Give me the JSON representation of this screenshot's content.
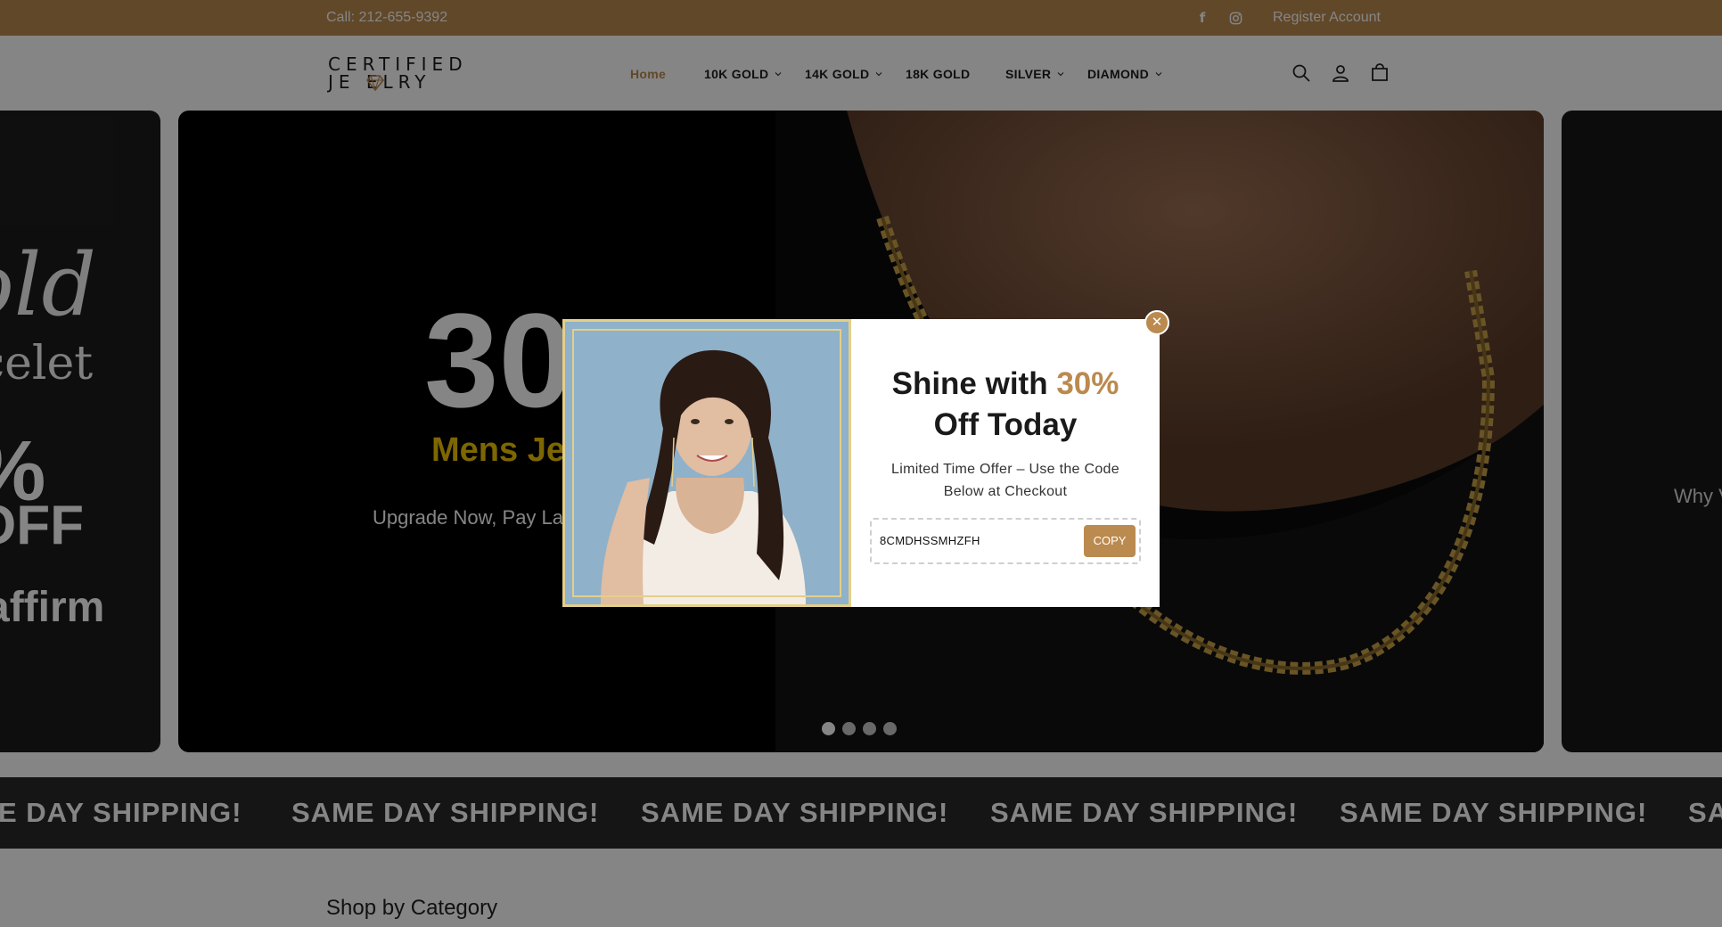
{
  "topbar": {
    "phone": "Call: 212-655-9392",
    "facebook_icon": "facebook-icon",
    "instagram_icon": "instagram-icon",
    "register": "Register Account"
  },
  "header": {
    "logo_line1": "CERTIFIED",
    "logo_line2": "JE  ELRY",
    "nav": [
      {
        "label": "Home",
        "active": true,
        "dropdown": false
      },
      {
        "label": "10K GOLD",
        "active": false,
        "dropdown": true
      },
      {
        "label": "14K GOLD",
        "active": false,
        "dropdown": true
      },
      {
        "label": "18K GOLD",
        "active": false,
        "dropdown": false
      },
      {
        "label": "SILVER",
        "active": false,
        "dropdown": true
      },
      {
        "label": "DIAMOND",
        "active": false,
        "dropdown": true
      }
    ],
    "icons": [
      "search-icon",
      "account-icon",
      "cart-icon"
    ]
  },
  "hero": {
    "left_slide": {
      "line1": "old",
      "line2": "celet",
      "line3": "%",
      "line4": "OFF",
      "line5": "affirm"
    },
    "main_slide": {
      "big": "30",
      "subtitle": "Mens Je",
      "desc": "Upgrade Now, Pay La"
    },
    "right_slide": {
      "text": "Why V"
    },
    "dots_active_index": 0,
    "dots_count": 4
  },
  "marquee": {
    "items": [
      "E DAY SHIPPING!",
      "SAME DAY SHIPPING!",
      "SAME DAY SHIPPING!",
      "SAME DAY SHIPPING!",
      "SAME DAY SHIPPING!",
      "SA"
    ]
  },
  "section": {
    "title": "Shop by Category"
  },
  "modal": {
    "heading_pre": "Shine with ",
    "heading_accent": "30%",
    "heading_post": "Off Today",
    "offer_line1": "Limited Time Offer – Use the Code",
    "offer_line2": "Below at Checkout",
    "code": "8CMDHSSMHZFH",
    "copy_label": "COPY",
    "close_icon": "close-icon"
  },
  "colors": {
    "brand": "#bb8a4f",
    "accent_yellow": "#f2c400",
    "dark": "#2a2a2a"
  }
}
